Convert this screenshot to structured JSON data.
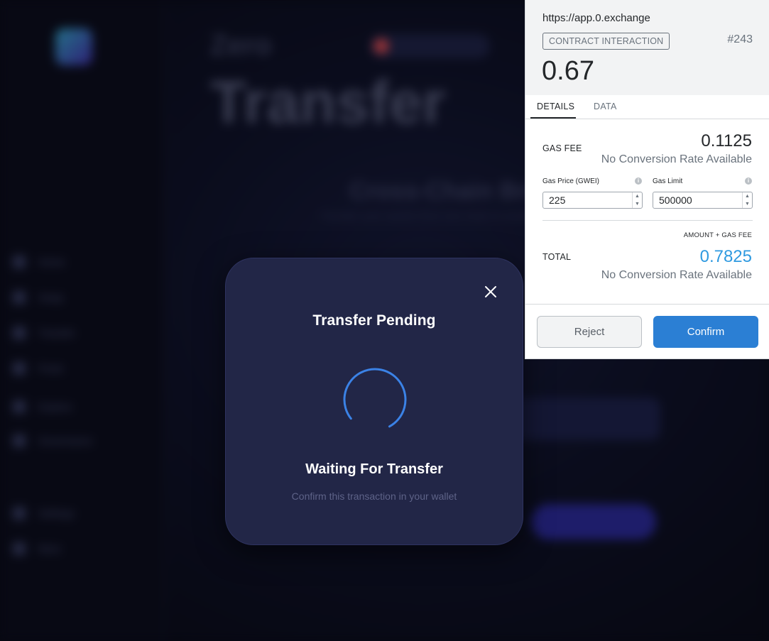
{
  "background_app": {
    "brand": "Zero",
    "page_title": "Transfer",
    "subtitle": "Cross-Chain Bridge",
    "description": "Transfer your assets from one chain to another",
    "nav_items": [
      "Home",
      "Swap",
      "Transfer",
      "Pools",
      "Explore",
      "Governance",
      "Settings",
      "More"
    ]
  },
  "modal": {
    "title": "Transfer Pending",
    "status": "Waiting For Transfer",
    "hint": "Confirm this transaction in your wallet",
    "close_icon": "close-icon",
    "spinner_color": "#3b82e6"
  },
  "wallet": {
    "origin": "https://app.0.exchange",
    "tag": "CONTRACT INTERACTION",
    "nonce": "#243",
    "amount": "0.67",
    "tabs": [
      {
        "label": "DETAILS",
        "active": true
      },
      {
        "label": "DATA",
        "active": false
      }
    ],
    "gas_fee": {
      "label": "GAS FEE",
      "value": "0.1125",
      "conversion": "No Conversion Rate Available"
    },
    "gas_price": {
      "label": "Gas Price (GWEI)",
      "value": "225"
    },
    "gas_limit": {
      "label": "Gas Limit",
      "value": "500000"
    },
    "total": {
      "caption": "AMOUNT + GAS FEE",
      "label": "TOTAL",
      "value": "0.7825",
      "conversion": "No Conversion Rate Available"
    },
    "reject_label": "Reject",
    "confirm_label": "Confirm",
    "accent": "#2b7fd4",
    "total_color": "#2f9ae0"
  }
}
